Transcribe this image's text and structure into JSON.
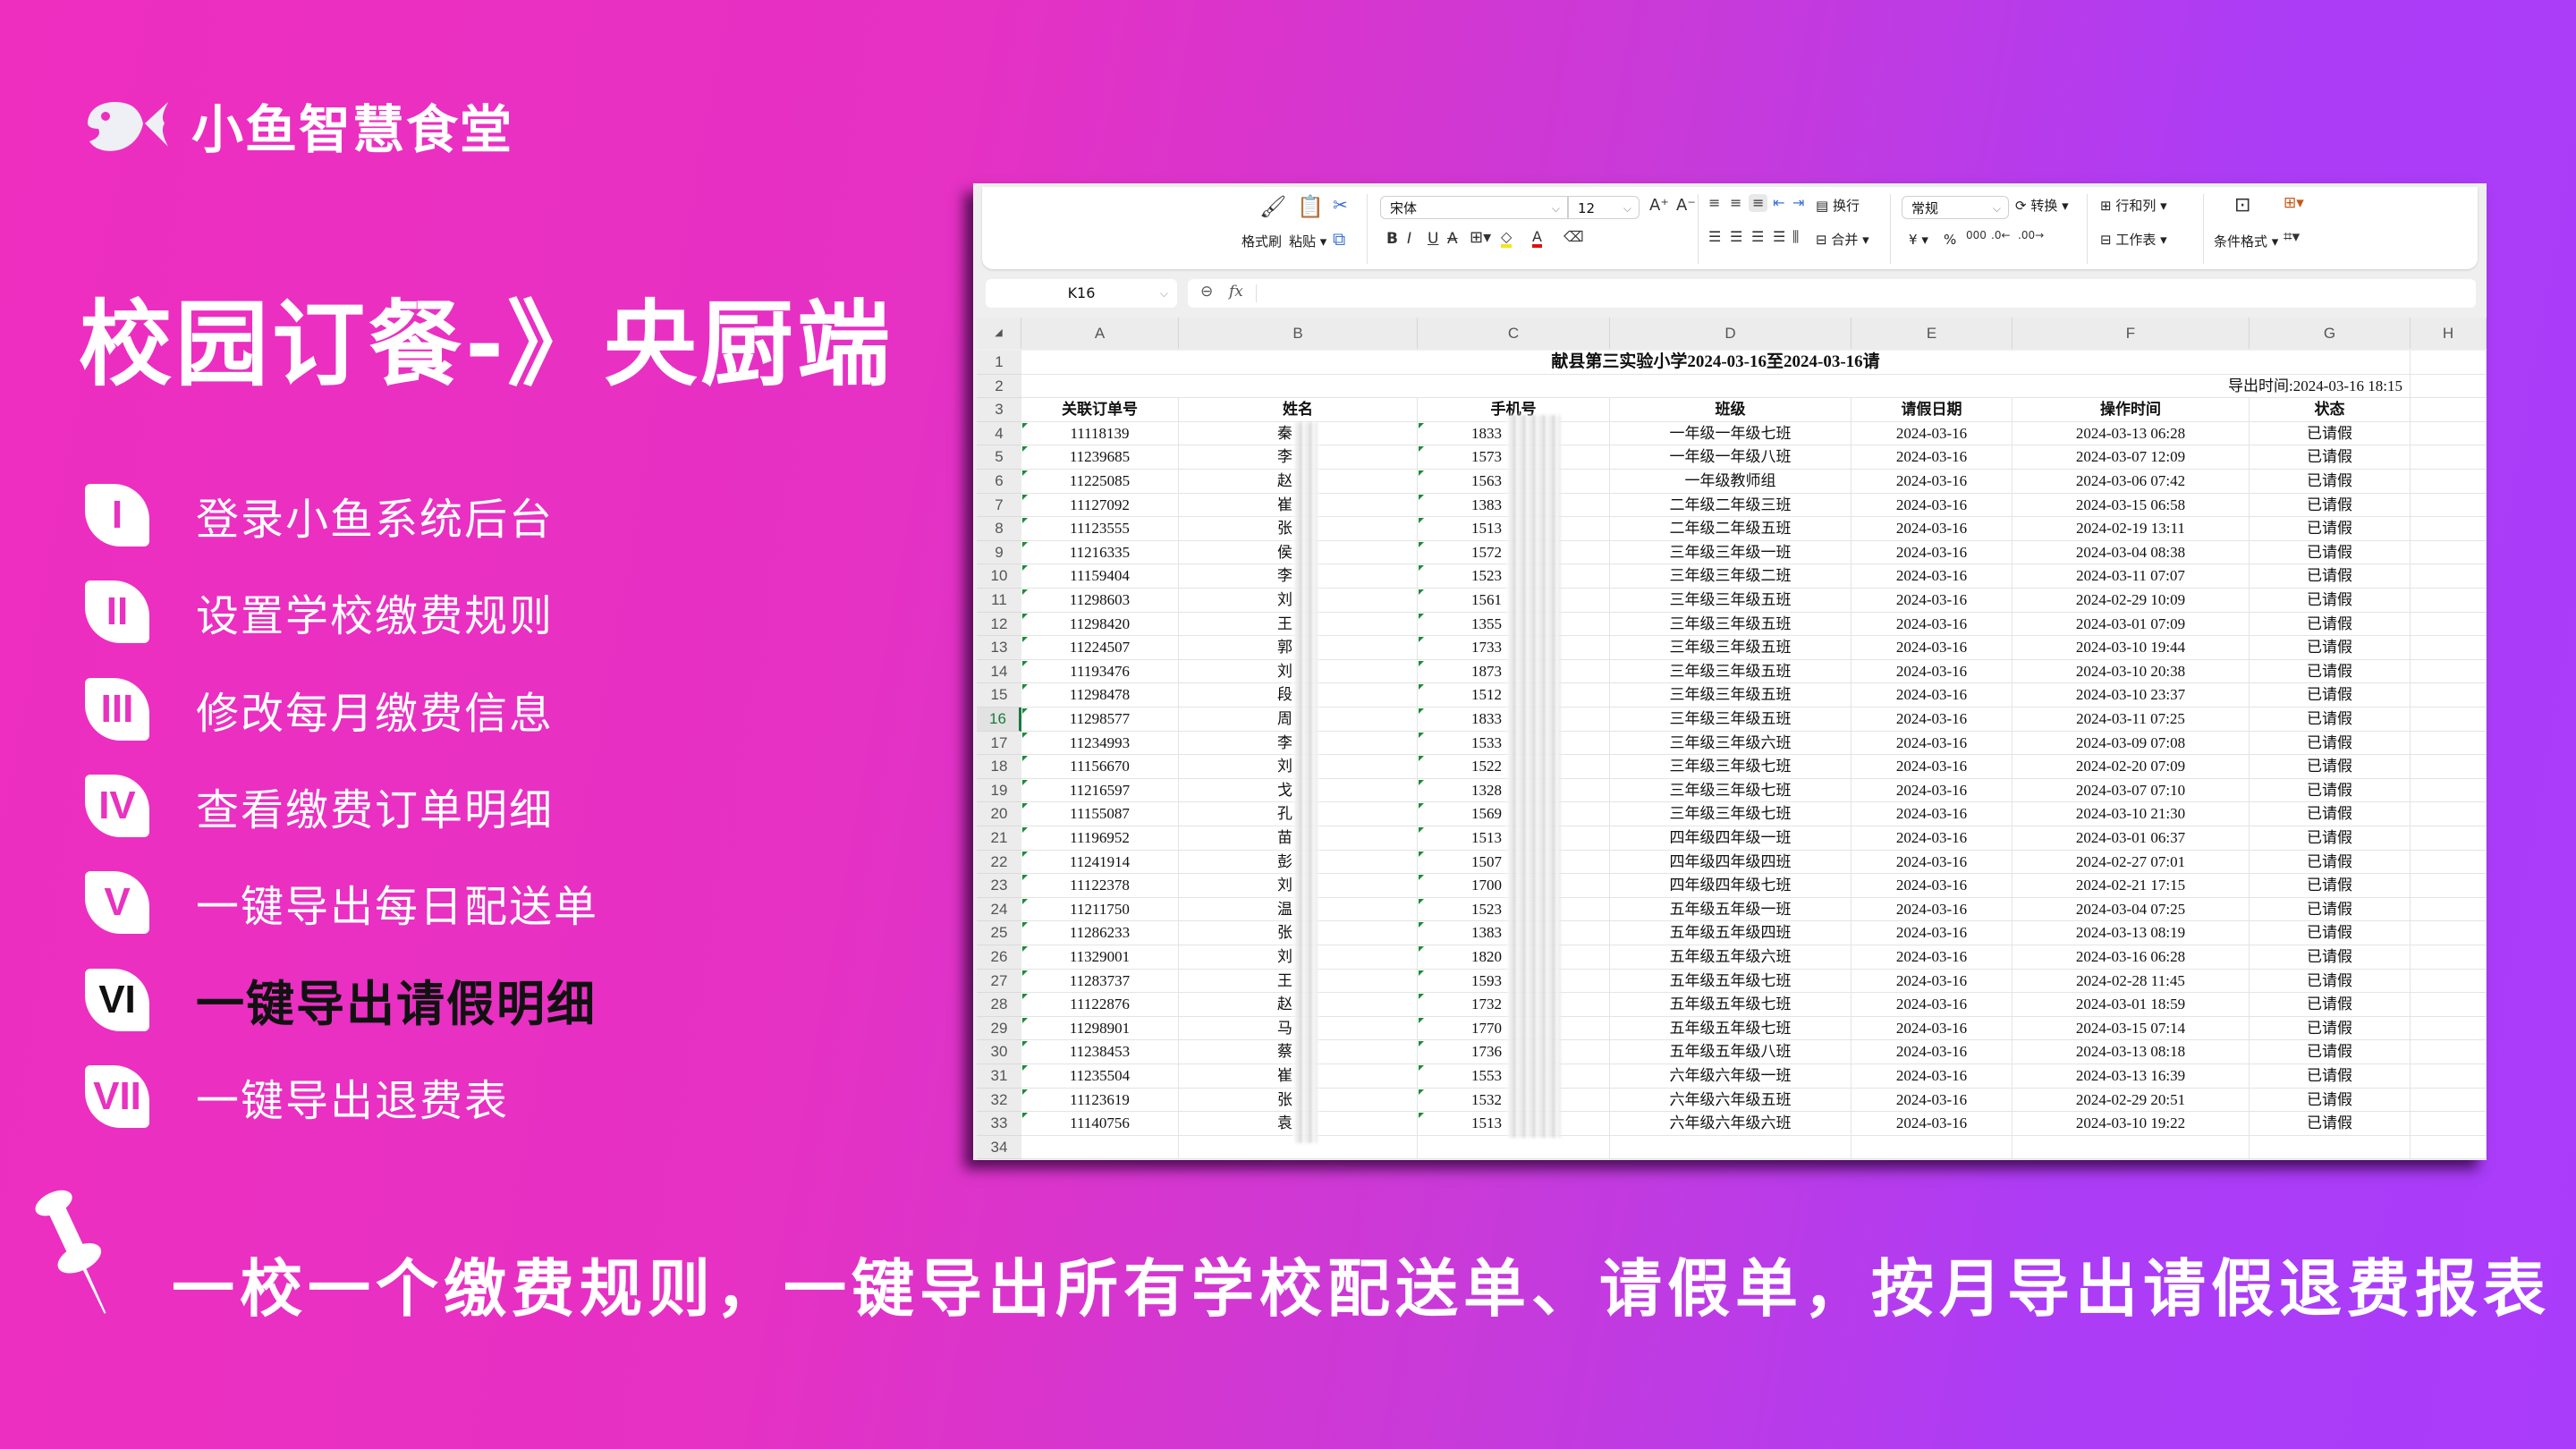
{
  "brand": {
    "name": "小鱼智慧食堂",
    "logo_icon": "fish-icon"
  },
  "title": "校园订餐-》央厨端",
  "steps": [
    {
      "numeral": "I",
      "label": "登录小鱼系统后台",
      "active": false
    },
    {
      "numeral": "II",
      "label": "设置学校缴费规则",
      "active": false
    },
    {
      "numeral": "III",
      "label": "修改每月缴费信息",
      "active": false
    },
    {
      "numeral": "IV",
      "label": "查看缴费订单明细",
      "active": false
    },
    {
      "numeral": "V",
      "label": "一键导出每日配送单",
      "active": false
    },
    {
      "numeral": "VI",
      "label": "一键导出请假明细",
      "active": true
    },
    {
      "numeral": "VII",
      "label": "一键导出退费表",
      "active": false
    }
  ],
  "tagline": "一校一个缴费规则，一键导出所有学校配送单、请假单，按月导出请假退费报表",
  "tagline_icon": "pushpin-icon",
  "spreadsheet": {
    "ribbon": {
      "format_painter": "格式刷",
      "paste": "粘贴",
      "font_name": "宋体",
      "font_size": "12",
      "wrap": "换行",
      "merge": "合并",
      "number_format": "常规",
      "convert": "转换",
      "rows_cols": "行和列",
      "worksheet": "工作表",
      "conditional_format": "条件格式",
      "currency_symbol": "¥",
      "percent": "%"
    },
    "name_box": "K16",
    "formula_icon": "fx",
    "formula_value": "",
    "columns": [
      "A",
      "B",
      "C",
      "D",
      "E",
      "F",
      "G",
      "H"
    ],
    "selected_row": 16,
    "sheet_title": "献县第三实验小学2024-03-16至2024-03-16请",
    "export_time": "导出时间:2024-03-16 18:15",
    "headers": [
      "关联订单号",
      "姓名",
      "手机号",
      "班级",
      "请假日期",
      "操作时间",
      "状态"
    ],
    "rows": [
      [
        "11118139",
        "秦",
        "1833",
        "一年级一年级七班",
        "2024-03-16",
        "2024-03-13 06:28",
        "已请假"
      ],
      [
        "11239685",
        "李",
        "1573",
        "一年级一年级八班",
        "2024-03-16",
        "2024-03-07 12:09",
        "已请假"
      ],
      [
        "11225085",
        "赵",
        "1563",
        "一年级教师组",
        "2024-03-16",
        "2024-03-06 07:42",
        "已请假"
      ],
      [
        "11127092",
        "崔",
        "1383",
        "二年级二年级三班",
        "2024-03-16",
        "2024-03-15 06:58",
        "已请假"
      ],
      [
        "11123555",
        "张",
        "1513",
        "二年级二年级五班",
        "2024-03-16",
        "2024-02-19 13:11",
        "已请假"
      ],
      [
        "11216335",
        "侯",
        "1572",
        "三年级三年级一班",
        "2024-03-16",
        "2024-03-04 08:38",
        "已请假"
      ],
      [
        "11159404",
        "李",
        "1523",
        "三年级三年级二班",
        "2024-03-16",
        "2024-03-11 07:07",
        "已请假"
      ],
      [
        "11298603",
        "刘",
        "1561",
        "三年级三年级五班",
        "2024-03-16",
        "2024-02-29 10:09",
        "已请假"
      ],
      [
        "11298420",
        "王",
        "1355",
        "三年级三年级五班",
        "2024-03-16",
        "2024-03-01 07:09",
        "已请假"
      ],
      [
        "11224507",
        "郭",
        "1733",
        "三年级三年级五班",
        "2024-03-16",
        "2024-03-10 19:44",
        "已请假"
      ],
      [
        "11193476",
        "刘",
        "1873",
        "三年级三年级五班",
        "2024-03-16",
        "2024-03-10 20:38",
        "已请假"
      ],
      [
        "11298478",
        "段",
        "1512",
        "三年级三年级五班",
        "2024-03-16",
        "2024-03-10 23:37",
        "已请假"
      ],
      [
        "11298577",
        "周",
        "1833",
        "三年级三年级五班",
        "2024-03-16",
        "2024-03-11 07:25",
        "已请假"
      ],
      [
        "11234993",
        "李",
        "1533",
        "三年级三年级六班",
        "2024-03-16",
        "2024-03-09 07:08",
        "已请假"
      ],
      [
        "11156670",
        "刘",
        "1522",
        "三年级三年级七班",
        "2024-03-16",
        "2024-02-20 07:09",
        "已请假"
      ],
      [
        "11216597",
        "戈",
        "1328",
        "三年级三年级七班",
        "2024-03-16",
        "2024-03-07 07:10",
        "已请假"
      ],
      [
        "11155087",
        "孔",
        "1569",
        "三年级三年级七班",
        "2024-03-16",
        "2024-03-10 21:30",
        "已请假"
      ],
      [
        "11196952",
        "苗",
        "1513",
        "四年级四年级一班",
        "2024-03-16",
        "2024-03-01 06:37",
        "已请假"
      ],
      [
        "11241914",
        "彭",
        "1507",
        "四年级四年级四班",
        "2024-03-16",
        "2024-02-27 07:01",
        "已请假"
      ],
      [
        "11122378",
        "刘",
        "1700",
        "四年级四年级七班",
        "2024-03-16",
        "2024-02-21 17:15",
        "已请假"
      ],
      [
        "11211750",
        "温",
        "1523",
        "五年级五年级一班",
        "2024-03-16",
        "2024-03-04 07:25",
        "已请假"
      ],
      [
        "11286233",
        "张",
        "1383",
        "五年级五年级四班",
        "2024-03-16",
        "2024-03-13 08:19",
        "已请假"
      ],
      [
        "11329001",
        "刘",
        "1820",
        "五年级五年级六班",
        "2024-03-16",
        "2024-03-16 06:28",
        "已请假"
      ],
      [
        "11283737",
        "王",
        "1593",
        "五年级五年级七班",
        "2024-03-16",
        "2024-02-28 11:45",
        "已请假"
      ],
      [
        "11122876",
        "赵",
        "1732",
        "五年级五年级七班",
        "2024-03-16",
        "2024-03-01 18:59",
        "已请假"
      ],
      [
        "11298901",
        "马",
        "1770",
        "五年级五年级七班",
        "2024-03-16",
        "2024-03-15 07:14",
        "已请假"
      ],
      [
        "11238453",
        "蔡",
        "1736",
        "五年级五年级八班",
        "2024-03-16",
        "2024-03-13 08:18",
        "已请假"
      ],
      [
        "11235504",
        "崔",
        "1553",
        "六年级六年级一班",
        "2024-03-16",
        "2024-03-13 16:39",
        "已请假"
      ],
      [
        "11123619",
        "张",
        "1532",
        "六年级六年级五班",
        "2024-03-16",
        "2024-02-29 20:51",
        "已请假"
      ],
      [
        "11140756",
        "袁",
        "1513",
        "六年级六年级六班",
        "2024-03-16",
        "2024-03-10 19:22",
        "已请假"
      ]
    ],
    "total_row_numbers": 34
  }
}
